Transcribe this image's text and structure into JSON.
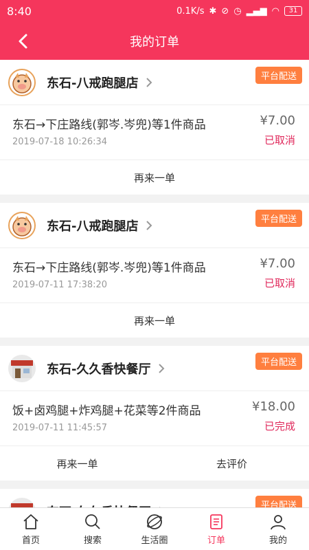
{
  "status": {
    "time": "8:40",
    "speed": "0.1K/s",
    "battery": "31"
  },
  "header": {
    "title": "我的订单"
  },
  "orders": [
    {
      "shop": "东石-八戒跑腿店",
      "tag": "平台配送",
      "items": "东石→下庄路线(郭岑.岑兜)等1件商品",
      "date": "2019-07-18 10:26:34",
      "price": "¥7.00",
      "state": "已取消",
      "actions": [
        "再来一单"
      ]
    },
    {
      "shop": "东石-八戒跑腿店",
      "tag": "平台配送",
      "items": "东石→下庄路线(郭岑.岑兜)等1件商品",
      "date": "2019-07-11 17:38:20",
      "price": "¥7.00",
      "state": "已取消",
      "actions": [
        "再来一单"
      ]
    },
    {
      "shop": "东石-久久香快餐厅",
      "tag": "平台配送",
      "items": "饭+卤鸡腿+炸鸡腿+花菜等2件商品",
      "date": "2019-07-11 11:45:57",
      "price": "¥18.00",
      "state": "已完成",
      "actions": [
        "再来一单",
        "去评价"
      ]
    },
    {
      "shop": "东石-久久香快餐厅",
      "tag": "平台配送"
    }
  ],
  "tabs": [
    {
      "label": "首页",
      "icon": "home-icon"
    },
    {
      "label": "搜索",
      "icon": "search-icon"
    },
    {
      "label": "生活圈",
      "icon": "planet-icon"
    },
    {
      "label": "订单",
      "icon": "order-icon"
    },
    {
      "label": "我的",
      "icon": "user-icon"
    }
  ],
  "colors": {
    "brand": "#f5365c",
    "tag": "#ff7f3f",
    "state": "#e0285b"
  }
}
